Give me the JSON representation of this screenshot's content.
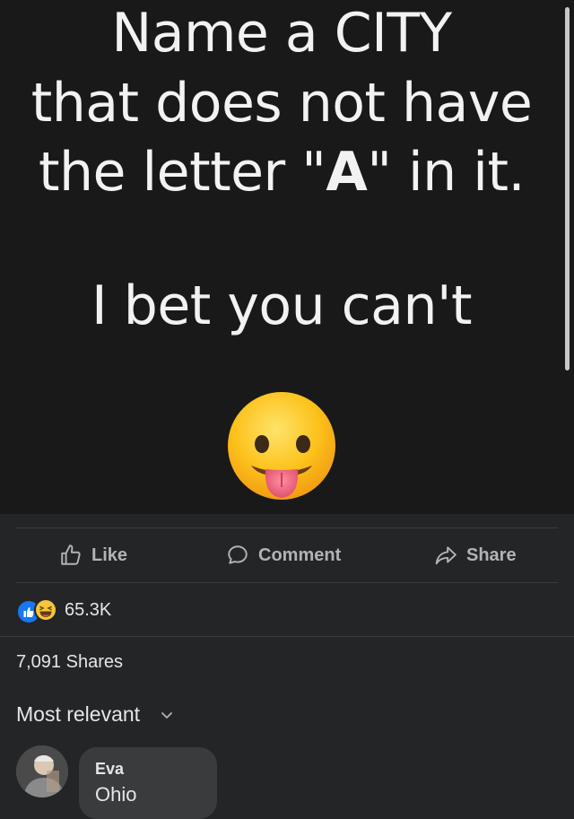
{
  "post": {
    "meme": {
      "line1": "Name a CITY",
      "line2": "that does not have",
      "line3_before": "the letter \"",
      "line3_bold": "A",
      "line3_after": "\" in it.",
      "line4": "I bet you can't"
    },
    "emoji": "face-with-tongue-icon"
  },
  "actions": {
    "like_label": "Like",
    "comment_label": "Comment",
    "share_label": "Share"
  },
  "reactions": {
    "icons": [
      "like-reaction-icon",
      "haha-reaction-icon"
    ],
    "count": "65.3K"
  },
  "shares": {
    "text": "7,091 Shares"
  },
  "comments": {
    "sort_label": "Most relevant",
    "items": [
      {
        "author": "Eva",
        "text": "Ohio"
      }
    ]
  },
  "colors": {
    "background": "#242526",
    "meme_background": "#191919",
    "like_blue": "#1877f2",
    "muted_text": "#b0b3b8"
  }
}
